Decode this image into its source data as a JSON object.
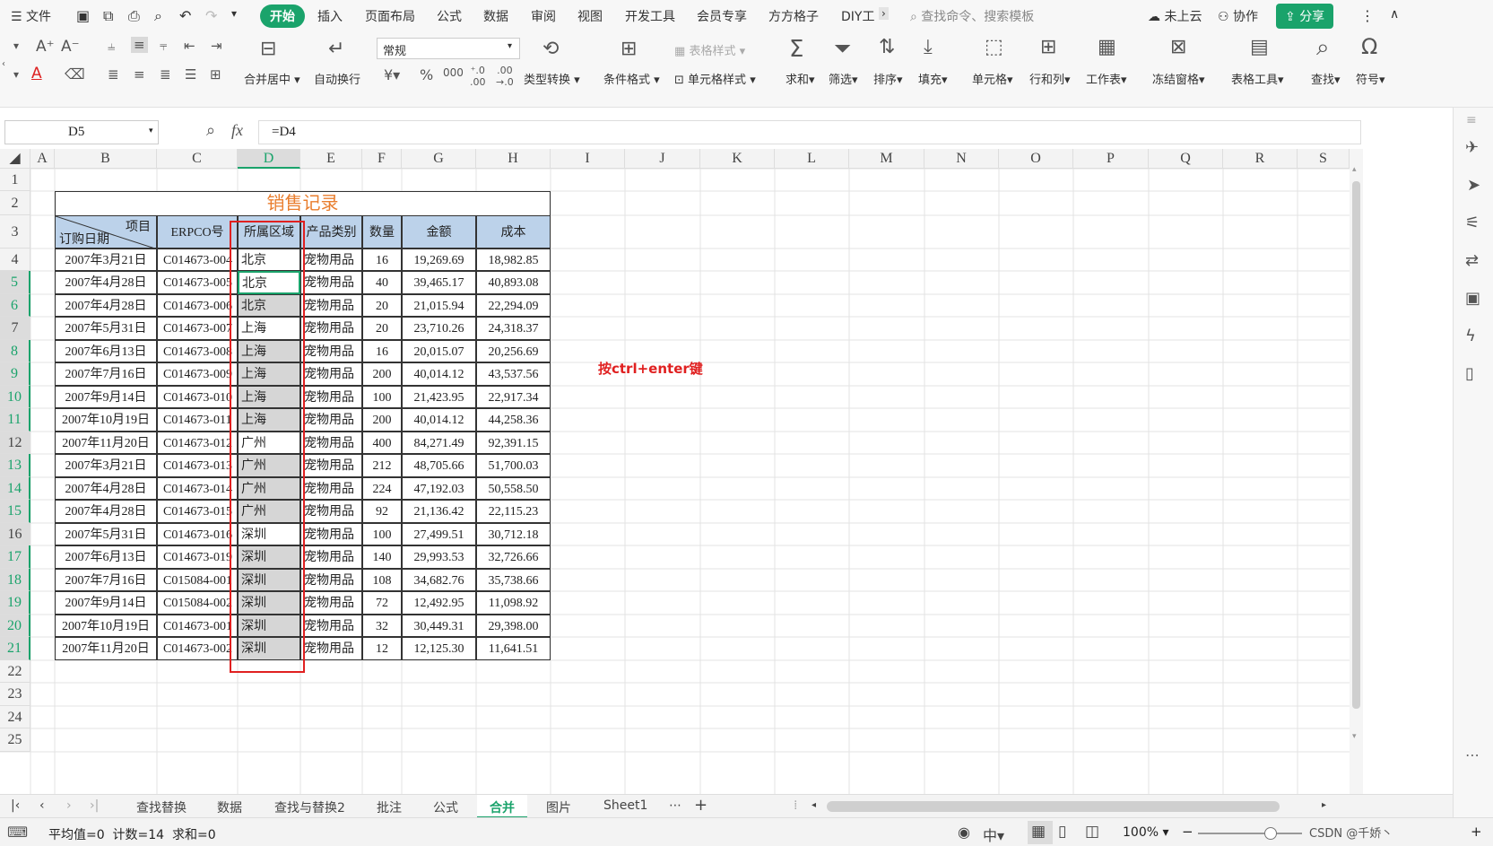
{
  "menu": {
    "hamburger_label": "文件",
    "items": [
      "开始",
      "插入",
      "页面布局",
      "公式",
      "数据",
      "审阅",
      "视图",
      "开发工具",
      "会员专享",
      "方方格子",
      "DIY工"
    ],
    "active_index": 0,
    "search_placeholder": "查找命令、搜索模板",
    "cloud_label": "未上云",
    "collab_label": "协作",
    "share_label": "分享"
  },
  "ribbon": {
    "merge_center": "合并居中",
    "auto_wrap": "自动换行",
    "number_format": "常规",
    "type_convert": "类型转换",
    "cond_format": "条件格式",
    "table_style": "表格样式",
    "cell_style": "单元格样式",
    "sum": "求和",
    "filter": "筛选",
    "sort": "排序",
    "fill": "填充",
    "cell": "单元格",
    "row_col": "行和列",
    "worksheet": "工作表",
    "freeze": "冻结窗格",
    "table_tools": "表格工具",
    "find": "查找",
    "symbol": "符号"
  },
  "formula_bar": {
    "name_box": "D5",
    "fx": "fx",
    "formula": "=D4"
  },
  "columns": [
    "A",
    "B",
    "C",
    "D",
    "E",
    "F",
    "G",
    "H",
    "I",
    "J",
    "K",
    "L",
    "M",
    "N",
    "O",
    "P",
    "Q",
    "R",
    "S"
  ],
  "rows": [
    "1",
    "2",
    "3",
    "4",
    "5",
    "6",
    "7",
    "8",
    "9",
    "10",
    "11",
    "12",
    "13",
    "14",
    "15",
    "16",
    "17",
    "18",
    "19",
    "20",
    "21",
    "22",
    "23",
    "24",
    "25"
  ],
  "table": {
    "title": "销售记录",
    "header_item": "项目",
    "header_date": "订购日期",
    "headers": [
      "ERPCO号",
      "所属区域",
      "产品类别",
      "数量",
      "金额",
      "成本"
    ],
    "data": [
      [
        "2007年3月21日",
        "C014673-004",
        "北京",
        "宠物用品",
        "16",
        "19,269.69",
        "18,982.85"
      ],
      [
        "2007年4月28日",
        "C014673-005",
        "北京",
        "宠物用品",
        "40",
        "39,465.17",
        "40,893.08"
      ],
      [
        "2007年4月28日",
        "C014673-006",
        "北京",
        "宠物用品",
        "20",
        "21,015.94",
        "22,294.09"
      ],
      [
        "2007年5月31日",
        "C014673-007",
        "上海",
        "宠物用品",
        "20",
        "23,710.26",
        "24,318.37"
      ],
      [
        "2007年6月13日",
        "C014673-008",
        "上海",
        "宠物用品",
        "16",
        "20,015.07",
        "20,256.69"
      ],
      [
        "2007年7月16日",
        "C014673-009",
        "上海",
        "宠物用品",
        "200",
        "40,014.12",
        "43,537.56"
      ],
      [
        "2007年9月14日",
        "C014673-010",
        "上海",
        "宠物用品",
        "100",
        "21,423.95",
        "22,917.34"
      ],
      [
        "2007年10月19日",
        "C014673-011",
        "上海",
        "宠物用品",
        "200",
        "40,014.12",
        "44,258.36"
      ],
      [
        "2007年11月20日",
        "C014673-012",
        "广州",
        "宠物用品",
        "400",
        "84,271.49",
        "92,391.15"
      ],
      [
        "2007年3月21日",
        "C014673-013",
        "广州",
        "宠物用品",
        "212",
        "48,705.66",
        "51,700.03"
      ],
      [
        "2007年4月28日",
        "C014673-014",
        "广州",
        "宠物用品",
        "224",
        "47,192.03",
        "50,558.50"
      ],
      [
        "2007年4月28日",
        "C014673-015",
        "广州",
        "宠物用品",
        "92",
        "21,136.42",
        "22,115.23"
      ],
      [
        "2007年5月31日",
        "C014673-016",
        "深圳",
        "宠物用品",
        "100",
        "27,499.51",
        "30,712.18"
      ],
      [
        "2007年6月13日",
        "C014673-019",
        "深圳",
        "宠物用品",
        "140",
        "29,993.53",
        "32,726.66"
      ],
      [
        "2007年7月16日",
        "C015084-001",
        "深圳",
        "宠物用品",
        "108",
        "34,682.76",
        "35,738.66"
      ],
      [
        "2007年9月14日",
        "C015084-002",
        "深圳",
        "宠物用品",
        "72",
        "12,492.95",
        "11,098.92"
      ],
      [
        "2007年10月19日",
        "C014673-001",
        "深圳",
        "宠物用品",
        "32",
        "30,449.31",
        "29,398.00"
      ],
      [
        "2007年11月20日",
        "C014673-002",
        "深圳",
        "宠物用品",
        "12",
        "12,125.30",
        "11,641.51"
      ]
    ]
  },
  "annotation": "按ctrl+enter键",
  "sheet_tabs": [
    "查找替换",
    "数据",
    "查找与替换2",
    "批注",
    "公式",
    "合并",
    "图片",
    "Sheet1"
  ],
  "active_sheet_index": 5,
  "status": {
    "summary": "平均值=0  计数=14  求和=0",
    "zoom": "100%",
    "watermark": "CSDN @千娇丶"
  },
  "colors": {
    "accent_green": "#1aa36b",
    "title_orange": "#e97e2e",
    "header_blue": "#bcd2ea",
    "highlight_red": "#e02020",
    "selected_gray": "#d6d6d6"
  }
}
